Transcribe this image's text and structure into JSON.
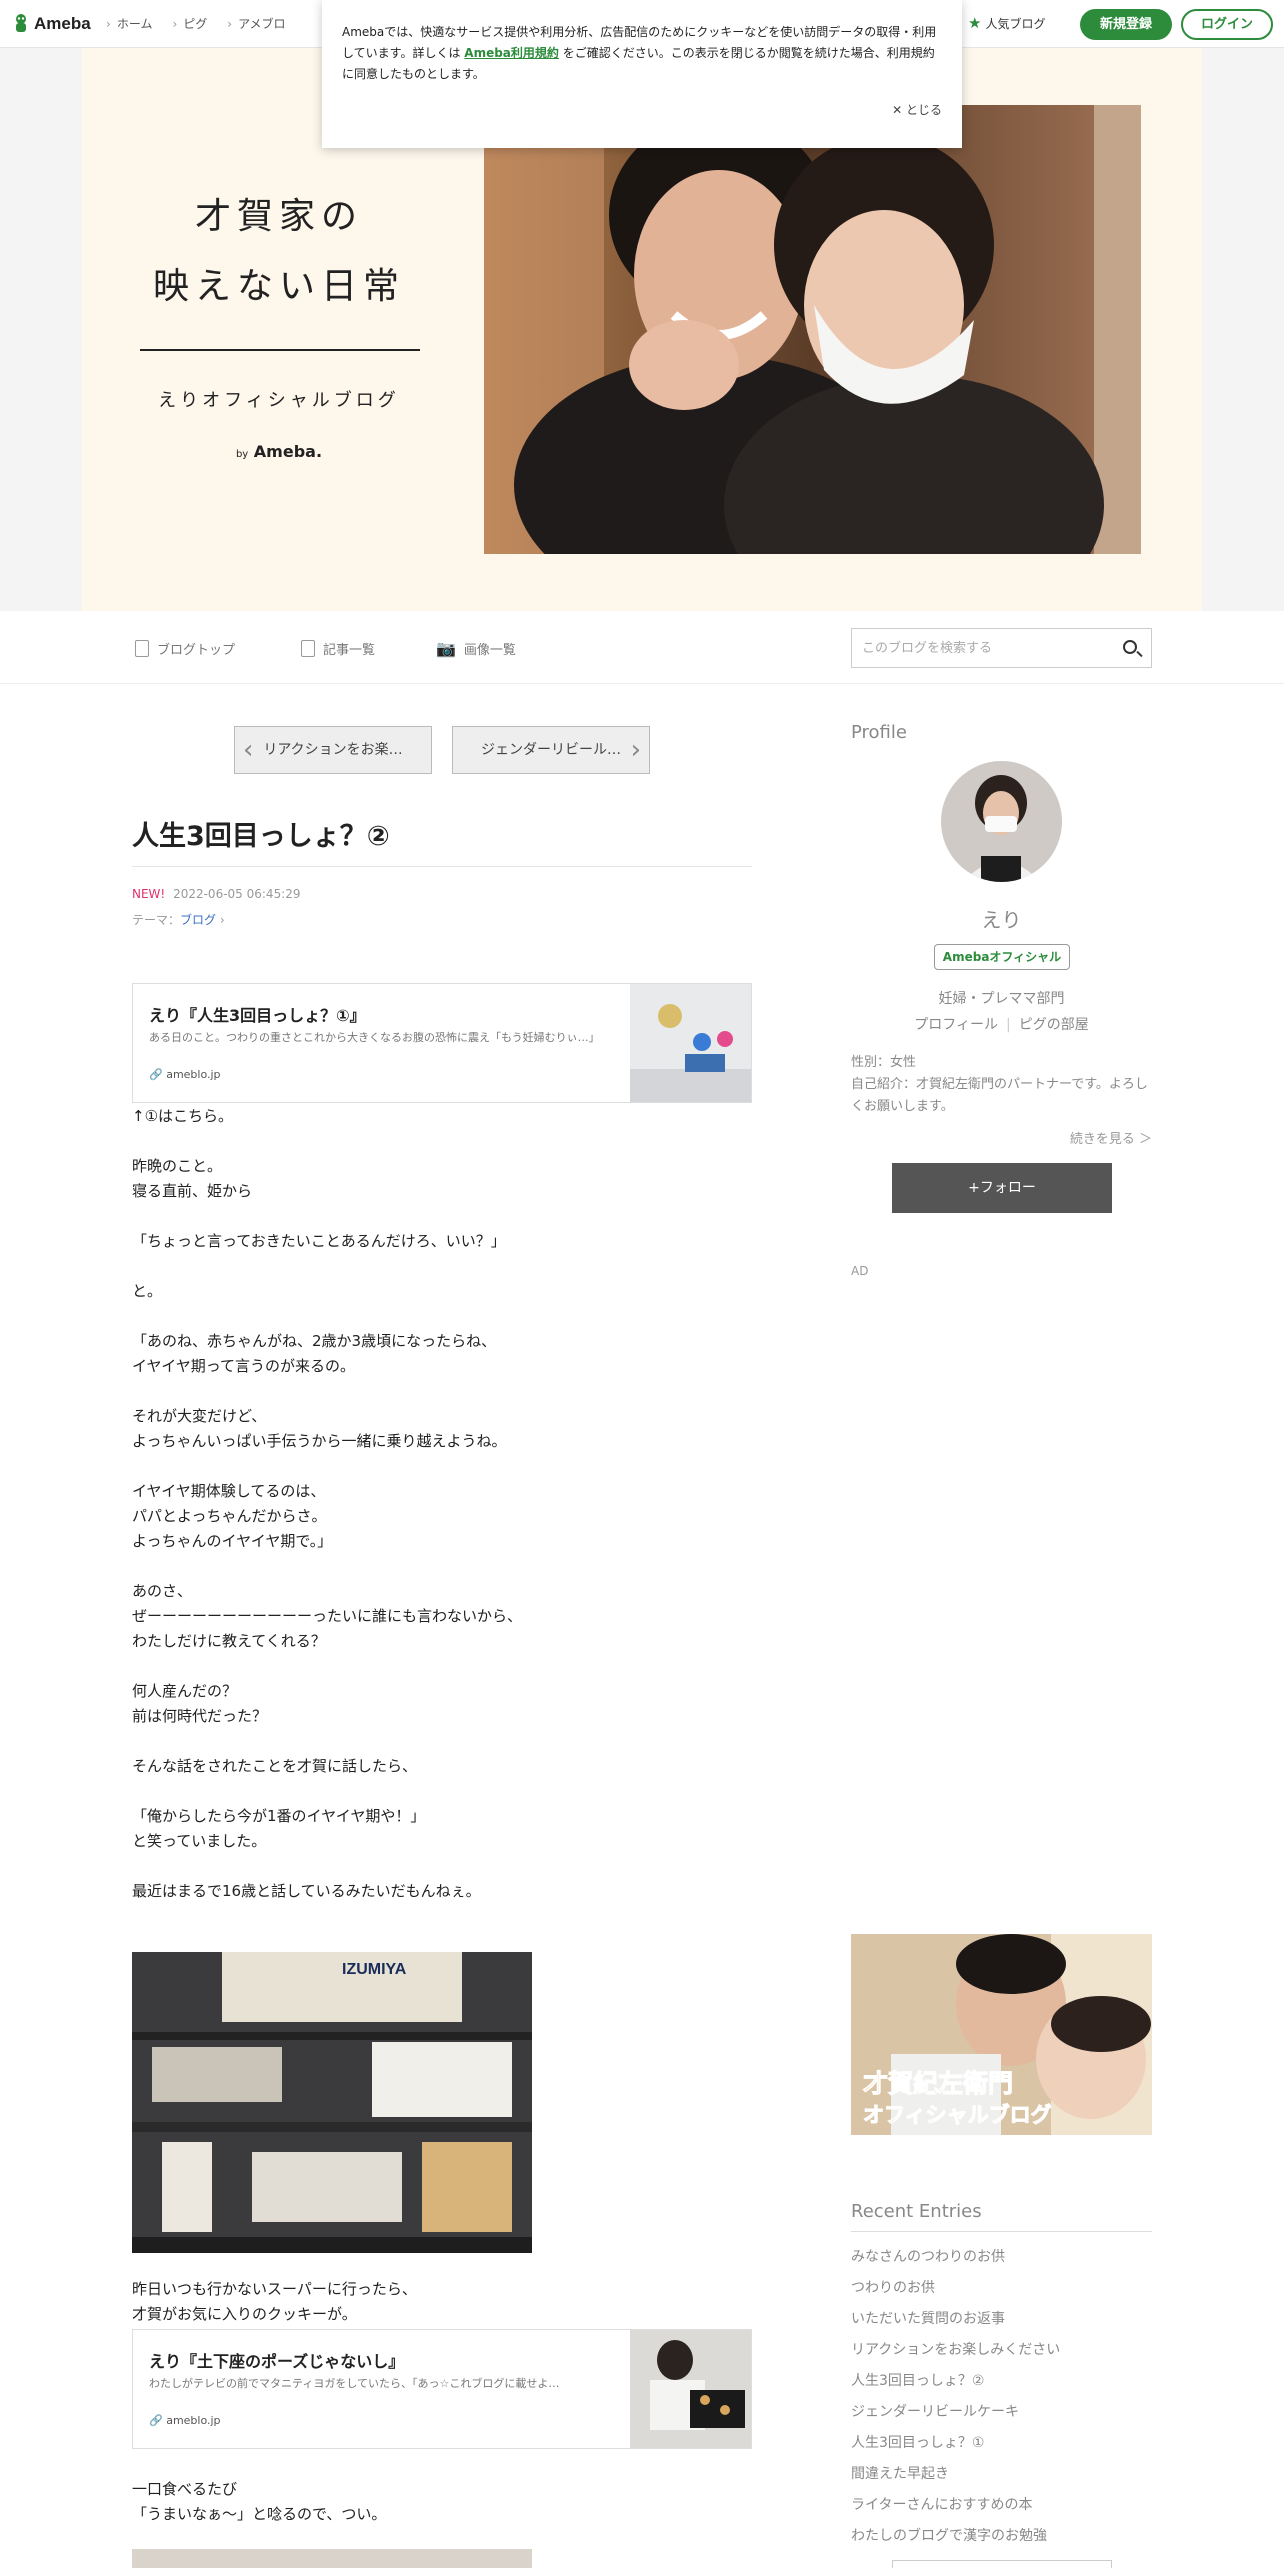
{
  "topbar": {
    "logo": "Ameba",
    "nav": [
      "ホーム",
      "ピグ",
      "アメブロ"
    ],
    "popular": "人気ブログ",
    "signup": "新規登録",
    "login": "ログイン"
  },
  "cookie": {
    "text1": "Amebaでは、快適なサービス提供や利用分析、広告配信のためにクッキーなどを使い訪問データの取得・利用しています。詳しくは",
    "link": "Ameba利用規約",
    "text2": "をご確認ください。この表示を閉じるか閲覧を続けた場合、利用規約に同意したものとします。",
    "close": "とじる"
  },
  "header": {
    "title_line1": "才賀家の",
    "title_line2": "映えない日常",
    "subtitle": "えりオフィシャルブログ",
    "by": "by",
    "brand": "Ameba."
  },
  "blognav": {
    "top": "ブログトップ",
    "list": "記事一覧",
    "images": "画像一覧",
    "search_placeholder": "このブログを検索する"
  },
  "pager": {
    "prev": "リアクションをお楽…",
    "next": "ジェンダーリビール…"
  },
  "article": {
    "title": "人生3回目っしょ？②",
    "new_label": "NEW!",
    "date": "2022-06-05 06:45:29",
    "theme_label": "テーマ：",
    "theme": "ブログ",
    "card1": {
      "title": "えり『人生3回目っしょ？①』",
      "desc": "ある日のこと。つわりの重さとこれから大きくなるお腹の恐怖に震え「もう妊婦むりぃ…」",
      "source": "ameblo.jp"
    },
    "para1": "↑①はこちら。\n\n昨晩のこと。\n寝る直前、姫から\n\n「ちょっと言っておきたいことあるんだけろ、いい？」\n\nと。\n\n「あのね、赤ちゃんがね、2歳か3歳頃になったらね、\nイヤイヤ期って言うのが来るの。\n\nそれが大変だけど、\nよっちゃんいっぱい手伝うから一緒に乗り越えようね。\n\nイヤイヤ期体験してるのは、\nパパとよっちゃんだからさ。\nよっちゃんのイヤイヤ期で。」\n\nあのさ、\nぜーーーーーーーーーーーったいに誰にも言わないから、\nわたしだけに教えてくれる？\n\n何人産んだの？\n前は何時代だった？\n\nそんな話をされたことを才賀に話したら、\n\n「俺からしたら今が1番のイヤイヤ期や！」\nと笑っていました。\n\n最近はまるで16歳と話しているみたいだもんねぇ。",
    "para2": "昨日いつも行かないスーパーに行ったら、\n才賀がお気に入りのクッキーが。",
    "card2": {
      "title": "えり『土下座のポーズじゃないし』",
      "desc": "わたしがテレビの前でマタニティヨガをしていたら、「あっ☆これブログに載せよ…",
      "source": "ameblo.jp"
    },
    "para3": "一口食べるたび\n「うまいなぁ〜」と唸るので、つい。",
    "photo_label": "IZUMIYA"
  },
  "sidebar": {
    "profile_heading": "Profile",
    "name": "えり",
    "badge": "Amebaオフィシャル",
    "category": "妊婦・プレママ部門",
    "link_profile": "プロフィール",
    "link_pig": "ピグの部屋",
    "gender": "性別：女性",
    "intro": "自己紹介：才賀紀左衛門のパートナーです。よろしくお願いします。",
    "more": "続きを見る ＞",
    "follow": "+フォロー",
    "ad": "AD",
    "banner_line1": "才賀紀左衛門",
    "banner_line2": "オフィシャルブログ",
    "recent_heading": "Recent Entries",
    "recent": [
      "みなさんのつわりのお供",
      "つわりのお供",
      "いただいた質問のお返事",
      "リアクションをお楽しみください",
      "人生3回目っしょ？②",
      "ジェンダーリビールケーキ",
      "人生3回目っしょ？①",
      "間違えた早起き",
      "ライターさんにおすすめの本",
      "わたしのブログで漢字のお勉強"
    ]
  }
}
